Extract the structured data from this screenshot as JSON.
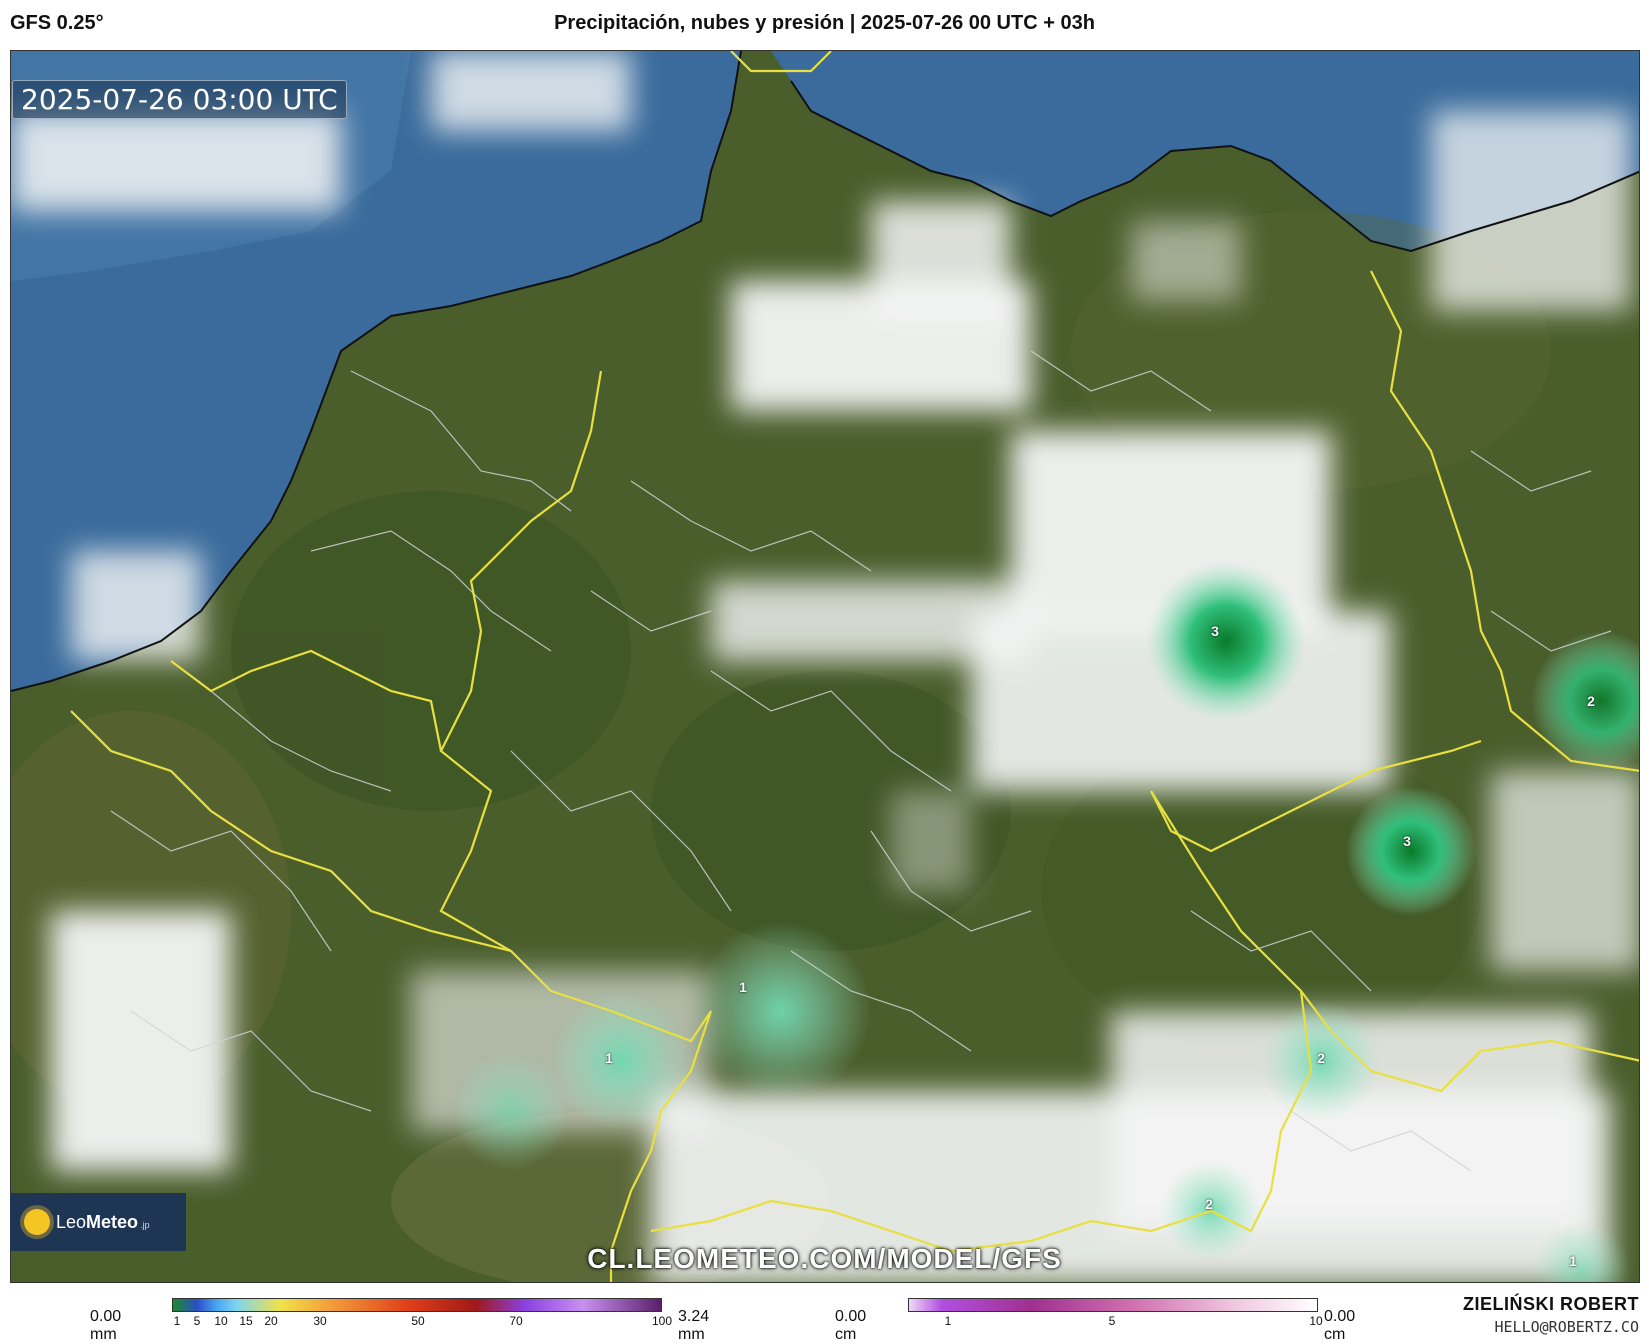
{
  "header": {
    "model": "GFS 0.25°",
    "title": "Precipitación, nubes y presión | 2025-07-26 00 UTC + 03h"
  },
  "map": {
    "valid_time": "2025-07-26 03:00 UTC",
    "watermark": "CL.LEOMETEO.COM/MODEL/GFS",
    "colors": {
      "sea": "#3a6b9c",
      "land": "#4a5e2c",
      "cloud": "#f4f6f6",
      "precip": "#2fbf7a",
      "border_country": "#e8e040",
      "border_region": "#cfd4d6"
    },
    "precip_labels": [
      "3",
      "2",
      "3",
      "1",
      "1",
      "2",
      "2",
      "1"
    ]
  },
  "logo": {
    "name_light": "Leo",
    "name_bold": "Meteo",
    "suffix": ".jp",
    "icon": "sun-icon"
  },
  "legend_rain": {
    "min_label": "0.00 mm",
    "max_label": "3.24 mm",
    "ticks": [
      "1",
      "5",
      "10",
      "15",
      "20",
      "30",
      "50",
      "70",
      "100"
    ]
  },
  "legend_snow": {
    "min_label": "0.00 cm",
    "max_label": "0.00 cm",
    "ticks": [
      "1",
      "5",
      "10"
    ]
  },
  "credit": {
    "author": "ZIELIŃSKI ROBERT",
    "email": "HELLO@ROBERTZ.CO"
  }
}
